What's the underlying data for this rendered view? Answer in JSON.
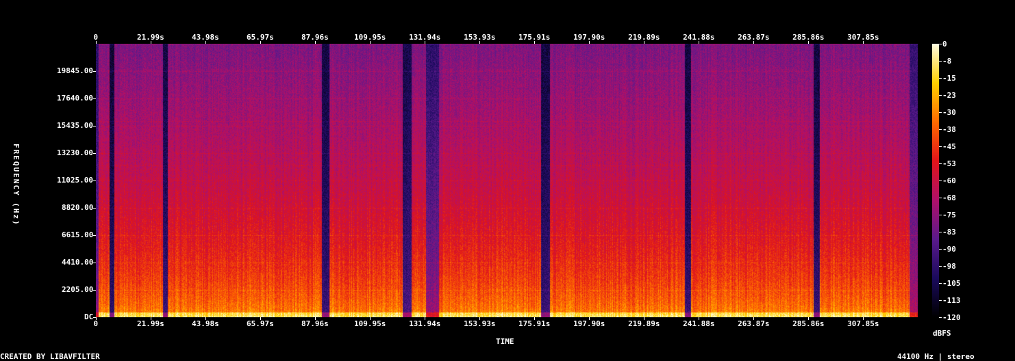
{
  "chart_data": {
    "type": "heatmap",
    "title": "",
    "xlabel": "TIME",
    "ylabel": "FREQUENCY (Hz)",
    "colorbar_label": "dBFS",
    "x_ticks": [
      "0",
      "21.99s",
      "43.98s",
      "65.97s",
      "87.96s",
      "109.95s",
      "131.94s",
      "153.93s",
      "175.91s",
      "197.90s",
      "219.89s",
      "241.88s",
      "263.87s",
      "285.86s",
      "307.85s"
    ],
    "x_tick_values": [
      0,
      21.99,
      43.98,
      65.97,
      87.96,
      109.95,
      131.94,
      153.93,
      175.91,
      197.9,
      219.89,
      241.88,
      263.87,
      285.86,
      307.85
    ],
    "y_ticks": [
      "DC",
      "2205.00",
      "4410.00",
      "6615.00",
      "8820.00",
      "11025.00",
      "13230.00",
      "15435.00",
      "17640.00",
      "19845.00"
    ],
    "y_tick_values": [
      0,
      2205,
      4410,
      6615,
      8820,
      11025,
      13230,
      15435,
      17640,
      19845
    ],
    "xlim": [
      0,
      329.8
    ],
    "ylim": [
      0,
      22050
    ],
    "colorbar_ticks": [
      "0",
      "-8",
      "-15",
      "-23",
      "-30",
      "-38",
      "-45",
      "-53",
      "-60",
      "-68",
      "-75",
      "-83",
      "-90",
      "-98",
      "-105",
      "-113",
      "-120"
    ],
    "colorbar_range": [
      -120,
      0
    ],
    "colormap": [
      "#000000",
      "#1a0a5c",
      "#5a1a8c",
      "#b0106a",
      "#e0141a",
      "#ff6a00",
      "#ffd000",
      "#fffbe0"
    ]
  },
  "footer": {
    "left": "CREATED BY LIBAVFILTER",
    "right": "44100 Hz | stereo"
  }
}
